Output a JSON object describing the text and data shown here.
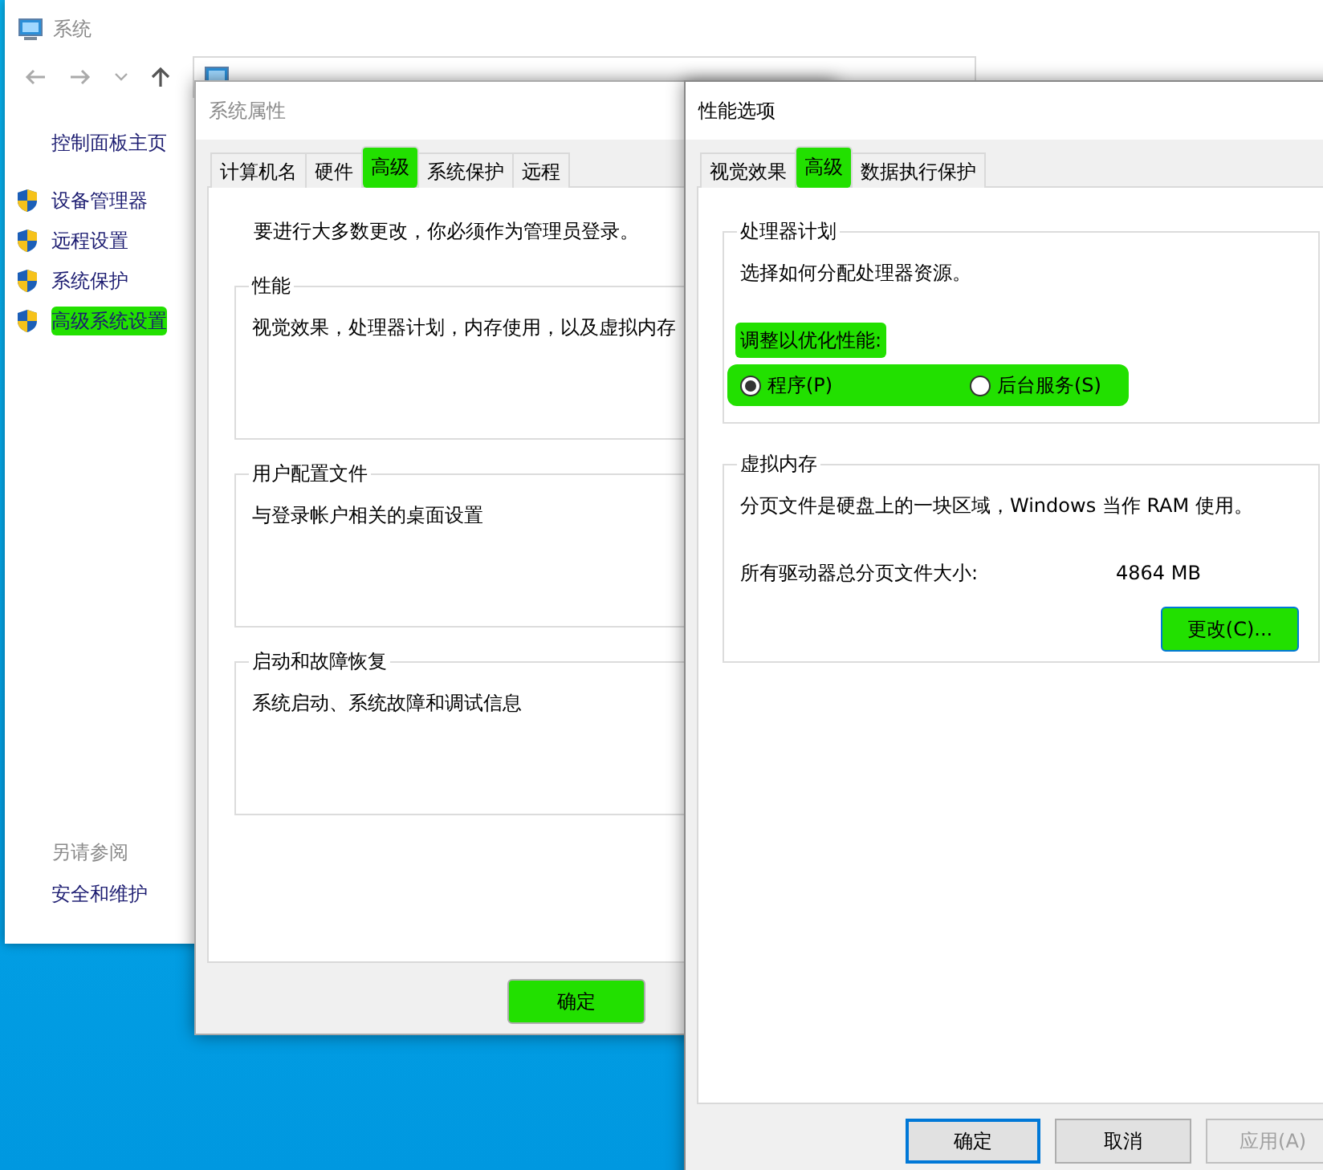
{
  "control_panel": {
    "title": "系统",
    "home_link": "控制面板主页",
    "tasks": [
      {
        "label": "设备管理器",
        "highlighted": false
      },
      {
        "label": "远程设置",
        "highlighted": false
      },
      {
        "label": "系统保护",
        "highlighted": false
      },
      {
        "label": "高级系统设置",
        "highlighted": true
      }
    ],
    "see_also_heading": "另请参阅",
    "see_also": [
      "安全和维护"
    ]
  },
  "system_properties": {
    "title": "系统属性",
    "tabs": [
      {
        "label": "计算机名",
        "selected": false,
        "highlighted": false
      },
      {
        "label": "硬件",
        "selected": false,
        "highlighted": false
      },
      {
        "label": "高级",
        "selected": true,
        "highlighted": true
      },
      {
        "label": "系统保护",
        "selected": false,
        "highlighted": false
      },
      {
        "label": "远程",
        "selected": false,
        "highlighted": false
      }
    ],
    "admin_note": "要进行大多数更改，你必须作为管理员登录。",
    "groups": [
      {
        "title": "性能",
        "description": "视觉效果，处理器计划，内存使用，以及虚拟内存"
      },
      {
        "title": "用户配置文件",
        "description": "与登录帐户相关的桌面设置"
      },
      {
        "title": "启动和故障恢复",
        "description": "系统启动、系统故障和调试信息"
      }
    ],
    "buttons": [
      {
        "label": "确定",
        "highlighted": true
      }
    ]
  },
  "performance_options": {
    "title": "性能选项",
    "tabs": [
      {
        "label": "视觉效果",
        "selected": false,
        "highlighted": false
      },
      {
        "label": "高级",
        "selected": true,
        "highlighted": true
      },
      {
        "label": "数据执行保护",
        "selected": false,
        "highlighted": false
      }
    ],
    "processor_group": {
      "title": "处理器计划",
      "description": "选择如何分配处理器资源。",
      "prompt": "调整以优化性能:",
      "prompt_highlighted": true,
      "options_highlighted": true,
      "options": [
        {
          "label": "程序(P)",
          "selected": true
        },
        {
          "label": "后台服务(S)",
          "selected": false
        }
      ]
    },
    "memory_group": {
      "title": "虚拟内存",
      "description": "分页文件是硬盘上的一块区域，Windows 当作 RAM 使用。",
      "total_label": "所有驱动器总分页文件大小:",
      "total_value": "4864 MB",
      "change_button": {
        "label": "更改(C)...",
        "highlighted": true
      }
    },
    "buttons": [
      {
        "label": "确定",
        "default": true,
        "disabled": false
      },
      {
        "label": "取消",
        "default": false,
        "disabled": false
      },
      {
        "label": "应用(A)",
        "default": false,
        "disabled": true
      }
    ]
  }
}
